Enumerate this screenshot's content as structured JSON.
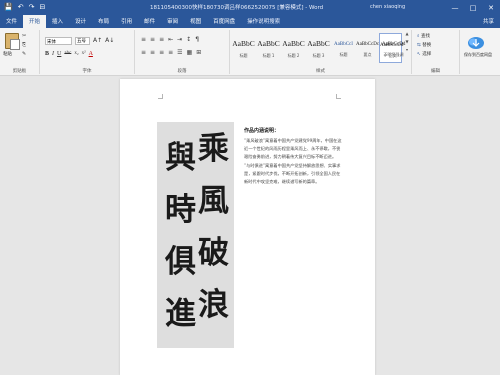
{
  "window": {
    "title": "181105400300快样180730调吕样0662520075 [兼容模式] - Word",
    "user": "chen xiaoqing",
    "buttons": [
      "—",
      "□",
      "✕"
    ],
    "qat": [
      "💾",
      "↶",
      "↷",
      "⊟"
    ]
  },
  "tabs": [
    "文件",
    "开始",
    "插入",
    "设计",
    "布局",
    "引用",
    "邮件",
    "审阅",
    "视图",
    "百度网盘",
    "操作说明搜索",
    "共享"
  ],
  "ribbon": {
    "clipboard": {
      "paste": "粘贴",
      "cut": "✂",
      "copy": "⎘",
      "format_painter": "✎",
      "label": "剪贴板"
    },
    "font": {
      "name": "宋体",
      "size": "五号",
      "bold": "B",
      "italic": "I",
      "underline": "U",
      "strike": "abc",
      "sub": "x₂",
      "sup": "x²",
      "grow": "A↑",
      "shrink": "A↓",
      "clear": "A",
      "label": "字体"
    },
    "paragraph": {
      "row1": [
        "≡",
        "≡",
        "≡",
        "⇤",
        "⇥",
        "↕",
        "¶"
      ],
      "row2": [
        "≡",
        "≡",
        "≡",
        "≡",
        "☰",
        "▦",
        "⊞"
      ],
      "label": "段落"
    },
    "styles": {
      "items": [
        {
          "sample": "AaBbC",
          "name": "标题",
          "small": false
        },
        {
          "sample": "AaBbC",
          "name": "标题 1",
          "small": false
        },
        {
          "sample": "AaBbC",
          "name": "标题 2",
          "small": false
        },
        {
          "sample": "AaBbC",
          "name": "标题 3",
          "small": false
        },
        {
          "sample": "AaBbCcI",
          "name": "标题",
          "small": true
        },
        {
          "sample": "AaBbCcDc",
          "name": "要点",
          "small": true
        },
        {
          "sample": "AaBbCcDd",
          "name": "↵ 正文",
          "small": true
        },
        {
          "sample": "AaBbCcDd",
          "name": "不明显强调",
          "small": true
        }
      ],
      "label": "样式"
    },
    "editing": {
      "find": "查找",
      "replace": "替换",
      "select": "选择",
      "label": "编辑"
    },
    "baidu": {
      "label": "保存到百度网盘"
    }
  },
  "document": {
    "calligraphy_left": [
      "與",
      "時",
      "俱",
      "進"
    ],
    "calligraphy_right": [
      "乘",
      "風",
      "破",
      "浪"
    ],
    "heading": "作品内涵说明：",
    "paragraphs": [
      "“乘风破浪”寓意着中国共产党建党99周年，中国在这近一个世纪的风雨历程里乘风而上、永不停歇，不畏艰险奋勇前进，努力朝着伟大复兴目标不断迈进。",
      "“与时俱进”寓意着中国共产党坚持解放思想、实事求是，紧跟时代步伐，不断开拓创新，引领全国人民在新时代中攻坚克难，继续谱写新的篇章。"
    ]
  }
}
